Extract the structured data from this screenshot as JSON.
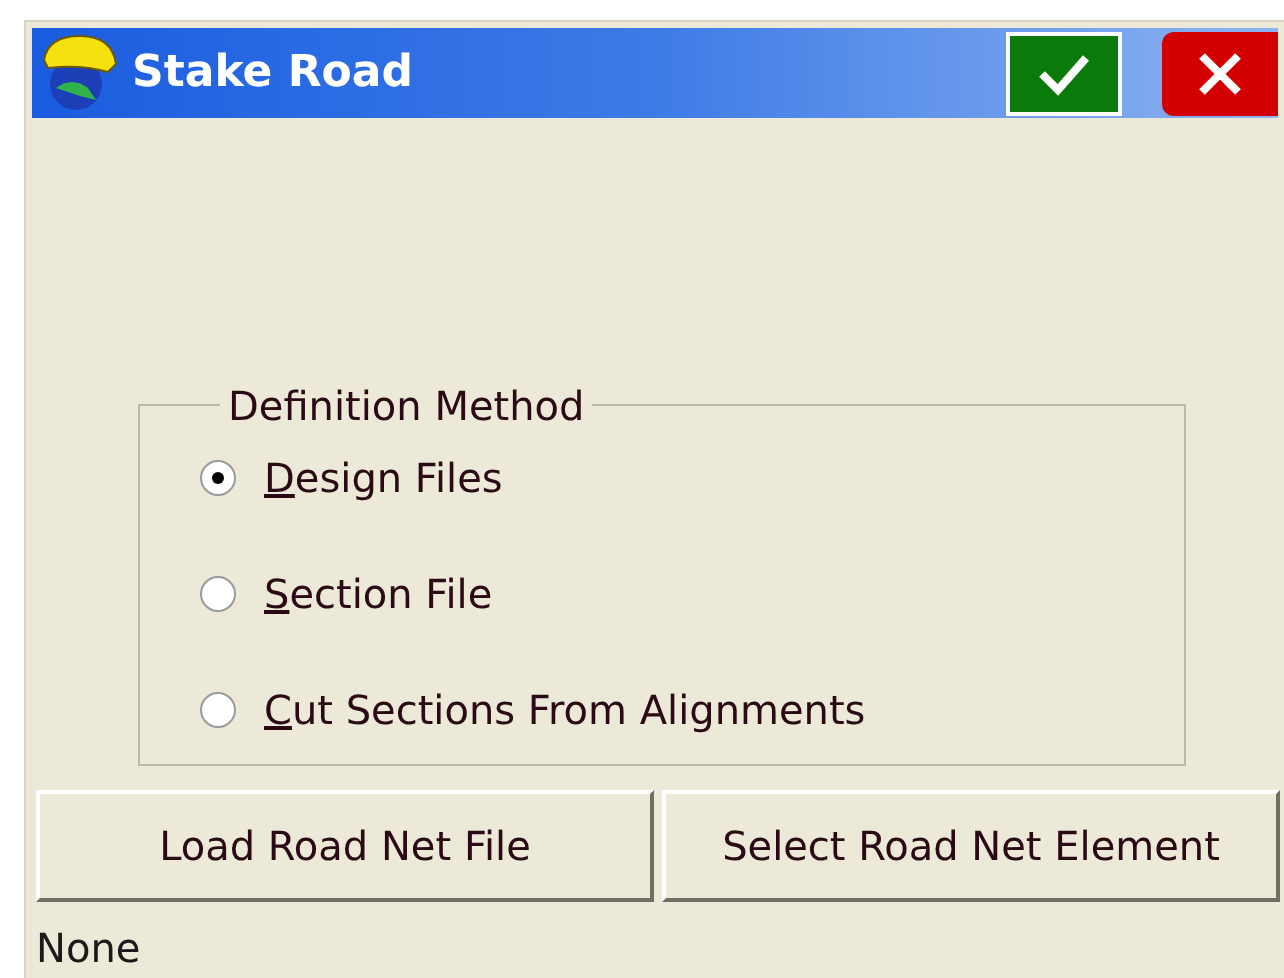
{
  "window": {
    "title": "Stake Road"
  },
  "group": {
    "title": "Definition Method",
    "options": [
      {
        "label": "Design Files",
        "selected": true
      },
      {
        "label": "Section File",
        "selected": false
      },
      {
        "label": "Cut Sections From Alignments",
        "selected": false
      }
    ]
  },
  "buttons": [
    "Load Road Net File",
    "Select Road Net Element"
  ],
  "status": "None"
}
